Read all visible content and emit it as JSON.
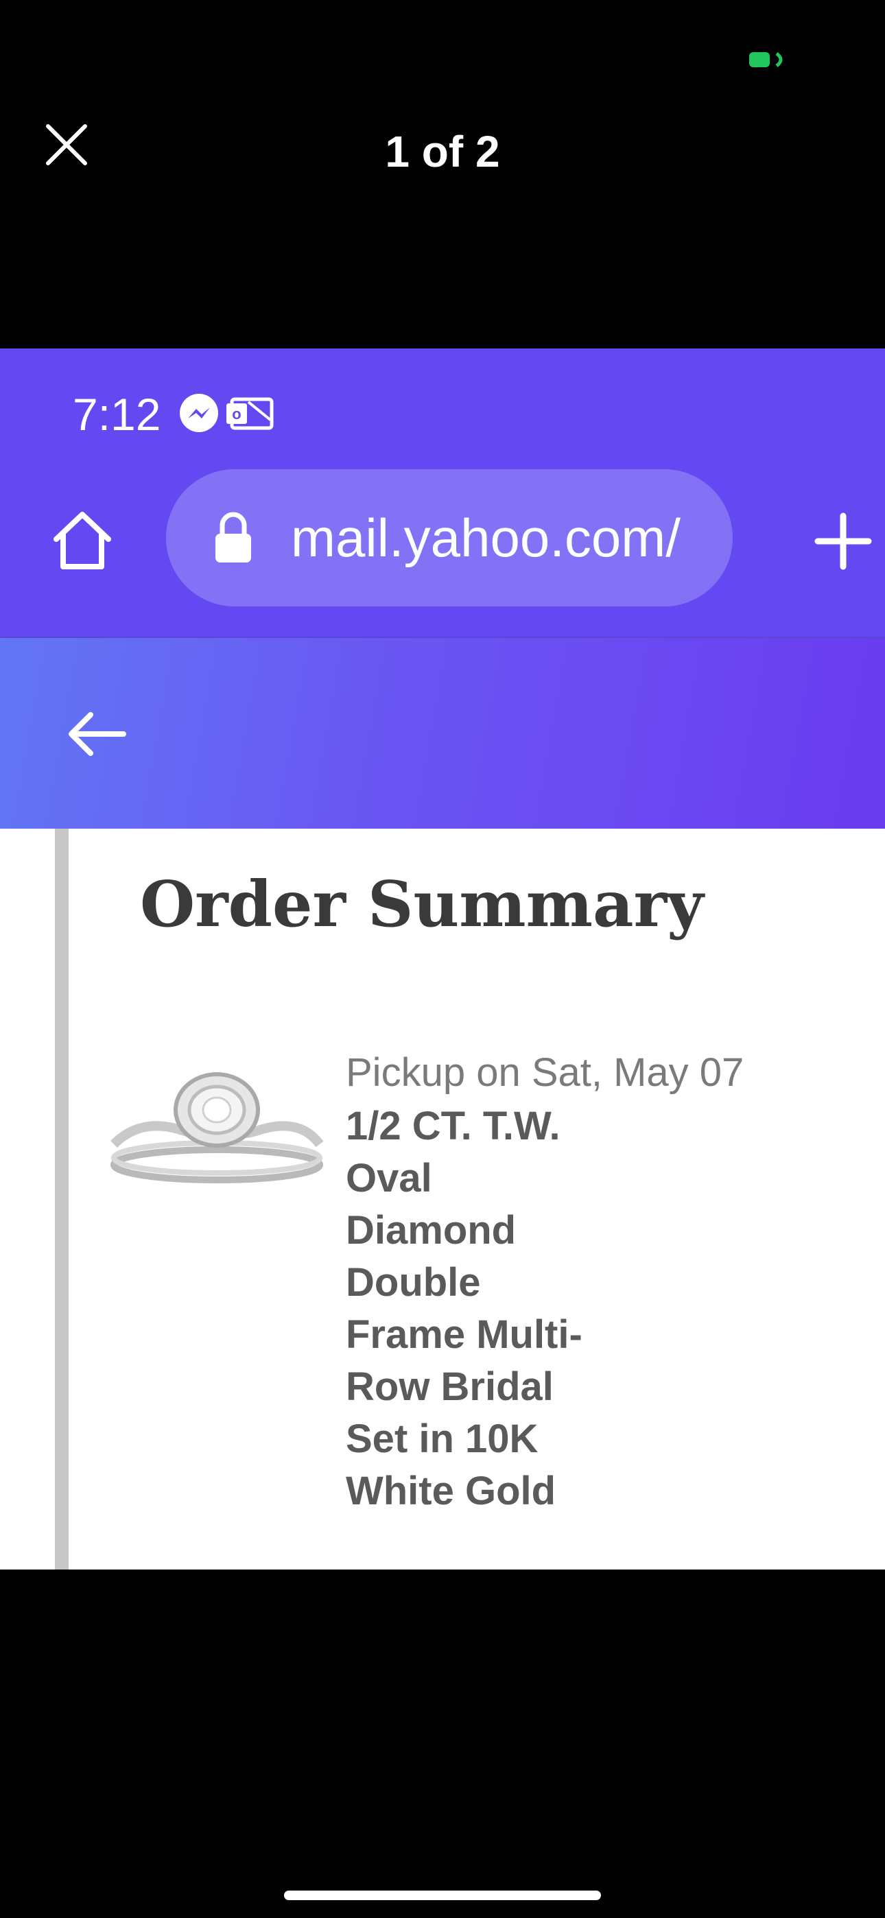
{
  "viewer": {
    "counter": "1 of 2",
    "close_icon": "close-icon",
    "battery_color": "#22c55e"
  },
  "inner_status": {
    "time": "7:12",
    "icons": [
      "messenger-icon",
      "outlook-icon"
    ]
  },
  "browser": {
    "url": "mail.yahoo.com/",
    "accent": "#6449f3",
    "icons": [
      "home-icon",
      "lock-icon",
      "plus-icon"
    ]
  },
  "mail_header": {
    "back_icon": "arrow-left-icon"
  },
  "email": {
    "title": "Order Summary",
    "item": {
      "pickup": "Pickup on Sat, May 07",
      "name": "1/2 CT. T.W.\nOval\nDiamond\nDouble\nFrame Multi-\nRow Bridal\nSet in 10K\nWhite Gold",
      "image": "ring-image"
    }
  }
}
